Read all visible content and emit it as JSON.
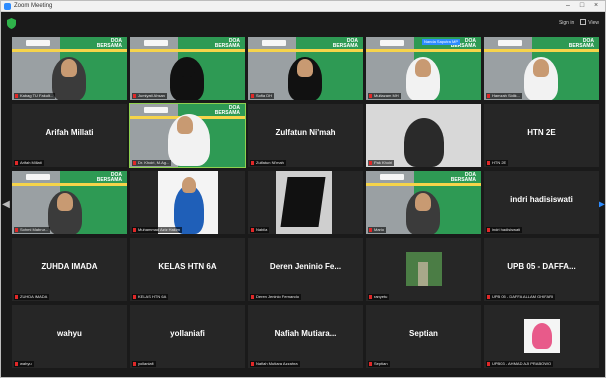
{
  "window": {
    "title": "Zoom Meeting"
  },
  "topbar": {
    "speaker_view": "Sign in",
    "view_label": "View"
  },
  "colors": {
    "tile_bg": "#262626",
    "active_border": "#8fd14f",
    "mic_muted": "#e02828",
    "nav_arrow": "#2d8cff"
  },
  "banner": {
    "line1": "DOA",
    "line2": "BERSAMA"
  },
  "tiles": [
    {
      "label": "Kabag TU Fakult...",
      "type": "video"
    },
    {
      "label": "Jumiyati Ahsan",
      "type": "video"
    },
    {
      "label": "Sofia DH",
      "type": "video"
    },
    {
      "label": "Multazam MH",
      "type": "video",
      "tag": "Nanda Saputra MP"
    },
    {
      "label": "Hamzah Sidik...",
      "type": "video"
    },
    {
      "label": "Arifah Millati",
      "name": "Arifah Millati",
      "type": "name"
    },
    {
      "label": "Dr. Khoiri, M.Ag...",
      "type": "video",
      "active": true
    },
    {
      "label": "Zulfatun Ni'mah",
      "name": "Zulfatun Ni'mah",
      "type": "name"
    },
    {
      "label": "Pak Khoiri",
      "type": "video"
    },
    {
      "label": "HTN 2E",
      "name": "HTN 2E",
      "type": "name"
    },
    {
      "label": "Sohmi Mabrur...",
      "type": "video"
    },
    {
      "label": "Muhammad Aziz Hakim",
      "type": "video"
    },
    {
      "label": "Nabila",
      "type": "video"
    },
    {
      "label": "Mario",
      "type": "video"
    },
    {
      "label": "indri hadisiswati",
      "name": "indri hadisiswati",
      "type": "name"
    },
    {
      "label": "ZUHDA IMADA",
      "name": "ZUHDA IMADA",
      "type": "name"
    },
    {
      "label": "KELAS HTN 6A",
      "name": "KELAS HTN 6A",
      "type": "name"
    },
    {
      "label": "Deren Jeninio Fernando",
      "name": "Deren Jeninio Fe...",
      "type": "name"
    },
    {
      "label": "ranyetu",
      "type": "video"
    },
    {
      "label": "UPB 05 - DAFFA ALLAM GHIFARI",
      "name": "UPB 05 - DAFFA...",
      "type": "name"
    },
    {
      "label": "wahyu",
      "name": "wahyu",
      "type": "name"
    },
    {
      "label": "yollaniafi",
      "name": "yollaniafi",
      "type": "name"
    },
    {
      "label": "Nafiah Mutiara Azzahra",
      "name": "Nafiah Mutiara...",
      "type": "name"
    },
    {
      "label": "Septian",
      "name": "Septian",
      "type": "name"
    },
    {
      "label": "UPB03 - AHMAD AJI PRABOWO",
      "type": "video"
    }
  ]
}
